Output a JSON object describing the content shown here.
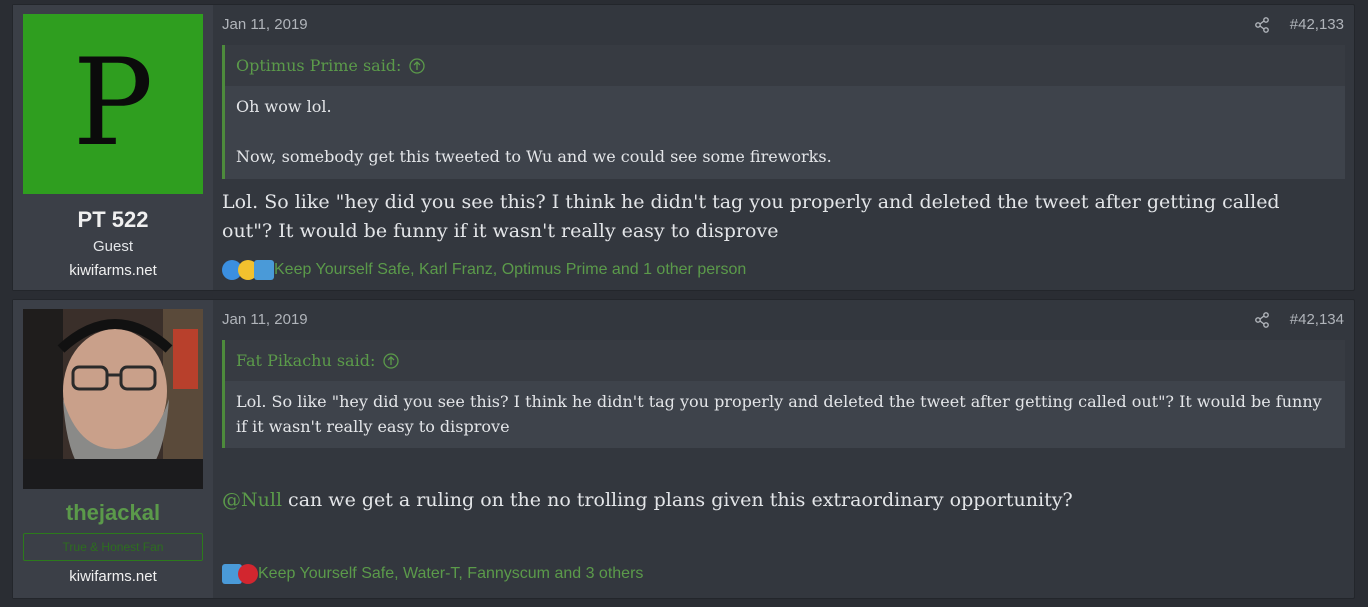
{
  "posts": [
    {
      "user": {
        "avatar_letter": "P",
        "name": "PT 522",
        "title": "Guest",
        "site": "kiwifarms.net"
      },
      "date": "Jan 11, 2019",
      "number": "#42,133",
      "quote": {
        "author": "Optimus Prime said:",
        "line1": "Oh wow lol.",
        "line2": "Now, somebody get this tweeted to Wu and we could see some fireworks."
      },
      "message": "Lol. So like \"hey did you see this? I think he didn't tag you properly and deleted the tweet after getting called out\"? It would be funny if it wasn't really easy to disprove",
      "reactions": "Keep Yourself Safe, Karl Franz, Optimus Prime and 1 other person"
    },
    {
      "user": {
        "name": "thejackal",
        "banner": "True & Honest Fan",
        "site": "kiwifarms.net"
      },
      "date": "Jan 11, 2019",
      "number": "#42,134",
      "quote": {
        "author": "Fat Pikachu said:",
        "line1": "Lol. So like \"hey did you see this? I think he didn't tag you properly and deleted the tweet after getting called out\"? It would be funny if it wasn't really easy to disprove"
      },
      "mention": "@Null",
      "message": " can we get a ruling on the no trolling plans given this extraordinary opportunity?",
      "reactions": "Keep Yourself Safe, Water-T, Fannyscum and 3 others"
    }
  ],
  "colors": {
    "accent": "#5b9a4a",
    "avatar_bg": "#2f9e1f",
    "panel": "#33373e",
    "userpane": "#3b3f47"
  }
}
